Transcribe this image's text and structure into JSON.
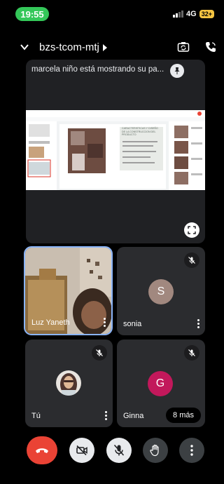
{
  "status_bar": {
    "time": "19:55",
    "network": "4G",
    "battery": "32+"
  },
  "header": {
    "meeting_code": "bzs-tcom-mtj"
  },
  "presentation": {
    "caption": "marcela niño está mostrando su pa...",
    "slide_title": "CARACTERISTICAS Y DISEÑO DE LA CONSTRUCCION DEL PRODUCTO"
  },
  "participants": [
    {
      "name": "Luz Yaneth"
    },
    {
      "name": "sonia",
      "initial": "S",
      "avatar_color": "#a1887f"
    },
    {
      "name": "Tú"
    },
    {
      "name": "Ginna",
      "initial": "G",
      "avatar_color": "#c2185b"
    }
  ],
  "more_participants": "8 más",
  "colors": {
    "end_call": "#ea4335",
    "speaker_border": "#8ab4f8",
    "status_green": "#34c759"
  }
}
